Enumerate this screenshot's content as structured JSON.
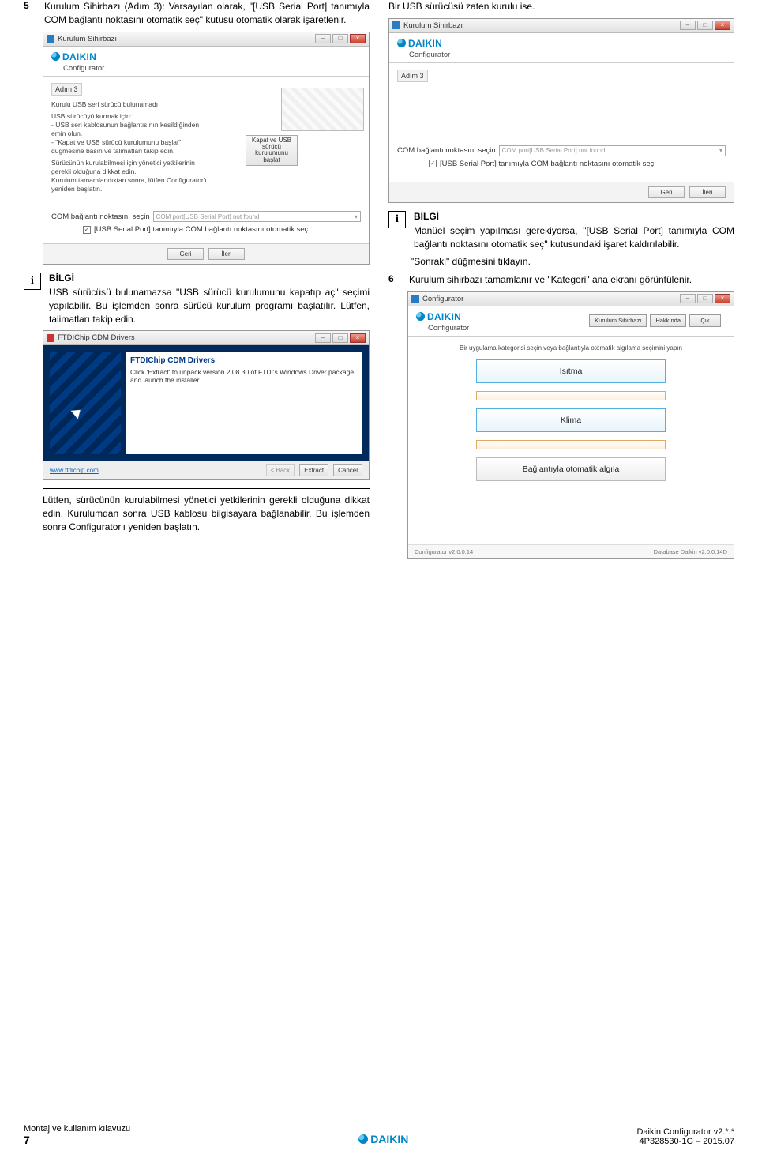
{
  "leftCol": {
    "step5": {
      "num": "5",
      "text": "Kurulum Sihirbazı (Adım 3): Varsayılan olarak, \"[USB Serial Port] tanımıyla COM bağlantı noktasını otomatik seç\" kutusu otomatik olarak işaretlenir."
    },
    "wizardA": {
      "title": "Kurulum Sihirbazı",
      "brand": "DAIKIN",
      "subtitle": "Configurator",
      "adim": "Adım 3",
      "line1": "Kurulu USB seri sürücü bulunamadı",
      "line2": "USB sürücüyü kurmak için:",
      "line3": "- USB seri kablosunun bağlantısının kesildiğinden emin olun.",
      "line4": "- \"Kapat ve USB sürücü kurulumunu başlat\" düğmesine basın ve talimatları takip edin.",
      "line5": "Sürücünün kurulabilmesi için yönetici yetkilerinin gerekli olduğuna dikkat edin.",
      "line6": "Kurulum tamamlandıktan sonra, lütfen Configurator'ı yeniden başlatın.",
      "innerBtn": "Kapat ve USB sürücü kurulumunu başlat",
      "comboLabel": "COM bağlantı noktasını seçin",
      "comboText": "COM port[USB Serial Port] not found",
      "chkText": "[USB Serial Port] tanımıyla COM bağlantı noktasını otomatik seç",
      "back": "Geri",
      "next": "İleri"
    },
    "info1": {
      "title": "BİLGİ",
      "text": "USB sürücüsü bulunamazsa \"USB sürücü kurulumunu kapatıp aç\" seçimi yapılabilir. Bu işlemden sonra sürücü kurulum programı başlatılır. Lütfen, talimatları takip edin."
    },
    "ftdi": {
      "title": "FTDIChip CDM Drivers",
      "heading": "FTDIChip CDM Drivers",
      "body": "Click 'Extract' to unpack version 2.08.30 of FTDI's Windows Driver package and launch the installer.",
      "link": "www.ftdichip.com",
      "back": "< Back",
      "extract": "Extract",
      "cancel": "Cancel"
    },
    "para2": "Lütfen, sürücünün kurulabilmesi yönetici yetkilerinin gerekli olduğuna dikkat edin. Kurulumdan sonra USB kablosu bilgisayara bağlanabilir. Bu işlemden sonra Configurator'ı yeniden başlatın."
  },
  "rightCol": {
    "topline": "Bir USB sürücüsü zaten kurulu ise.",
    "wizardB": {
      "title": "Kurulum Sihirbazı",
      "brand": "DAIKIN",
      "subtitle": "Configurator",
      "adim": "Adım 3",
      "comboLabel": "COM bağlantı noktasını seçin",
      "comboText": "COM port[USB Serial Port] not found",
      "chkText": "[USB Serial Port] tanımıyla COM bağlantı noktasını otomatik seç",
      "back": "Geri",
      "next": "İleri"
    },
    "info2": {
      "title": "BİLGİ",
      "text": "Manüel seçim yapılması gerekiyorsa, \"[USB Serial Port] tanımıyla COM bağlantı noktasını otomatik seç\" kutusundaki işaret kaldırılabilir."
    },
    "paraNext": "\"Sonraki\" düğmesini tıklayın.",
    "step6": {
      "num": "6",
      "text": "Kurulum sihirbazı tamamlanır ve \"Kategori\" ana ekranı görüntülenir."
    },
    "catWin": {
      "title": "Configurator",
      "brand": "DAIKIN",
      "sub": "Configurator",
      "btnWizard": "Kurulum Sihirbazı",
      "btnAbout": "Hakkında",
      "btnExit": "Çık",
      "note": "Bir uygulama kategorisi seçin veya bağlantıyla otomatik algılama seçimini yapın",
      "cat1": "Isıtma",
      "cat2": "Klima",
      "cat3": "Bağlantıyla otomatik algıla",
      "ver1": "Configurator v2.0.0.14",
      "ver2": "Database Daikin v2.0.0.14D"
    }
  },
  "footer": {
    "leftTop": "Montaj ve kullanım kılavuzu",
    "leftBottom": "7",
    "centerBrand": "DAIKIN",
    "rightTop": "Daikin Configurator v2.*.*",
    "rightBottom": "4P328530-1G – 2015.07"
  }
}
